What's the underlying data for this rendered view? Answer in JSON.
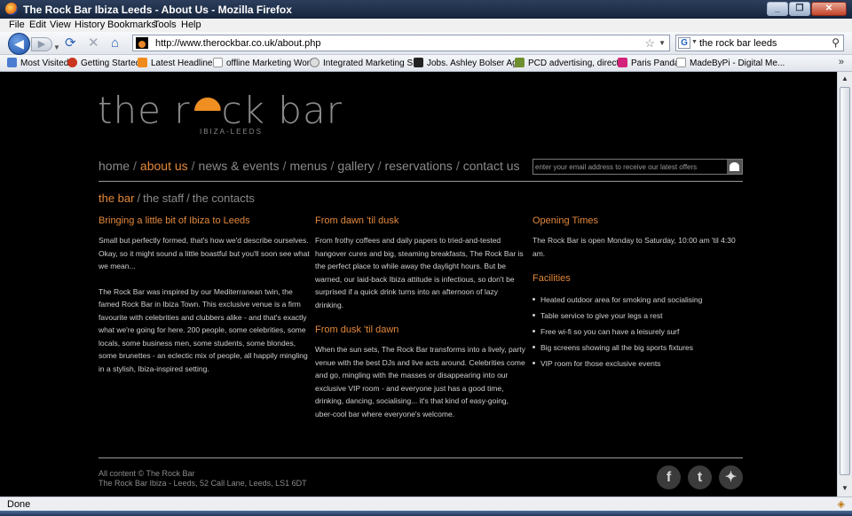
{
  "window": {
    "title": "The Rock Bar Ibiza Leeds - About Us - Mozilla Firefox"
  },
  "menubar": [
    "File",
    "Edit",
    "View",
    "History",
    "Bookmarks",
    "Tools",
    "Help"
  ],
  "navbar": {
    "url": "http://www.therockbar.co.uk/about.php",
    "search_value": "the rock bar leeds"
  },
  "bookmarks": [
    {
      "label": "Most Visited",
      "color": "#4a7dd0"
    },
    {
      "label": "Getting Started",
      "color": "#c9351e"
    },
    {
      "label": "Latest Headlines",
      "color": "#f08a1c"
    },
    {
      "label": "offline Marketing Work",
      "color": "#ffffff"
    },
    {
      "label": "Integrated Marketing S...",
      "color": "#bbbbbb"
    },
    {
      "label": "Jobs. Ashley Bolser Ag...",
      "color": "#222222"
    },
    {
      "label": "PCD advertising, direct...",
      "color": "#6d8f2f"
    },
    {
      "label": "Paris Panda",
      "color": "#d4237a"
    },
    {
      "label": "MadeByPi - Digital Me...",
      "color": "#ffffff"
    }
  ],
  "site": {
    "logo_text_before": "the r",
    "logo_text_after": "ck bar",
    "logo_sub": "IBIZA-LEEDS",
    "nav": [
      "home",
      "about us",
      "news & events",
      "menus",
      "gallery",
      "reservations",
      "contact us"
    ],
    "newsletter_placeholder": "enter your email address to receive our latest offers",
    "subnav": [
      "the bar",
      "the staff",
      "the contacts"
    ],
    "columns": {
      "left": {
        "heading": "Bringing a little bit of Ibiza to Leeds",
        "p1": "Small but perfectly formed, that's how we'd describe ourselves. Okay, so it might sound a little boastful but you'll soon see what we mean...",
        "p2": "The Rock Bar was inspired by our Mediterranean twin, the famed Rock Bar in Ibiza Town. This exclusive venue is a firm favourite with celebrities and clubbers alike - and that's exactly what we're going for here. 200 people, some celebrities, some locals, some business men, some students, some blondes, some brunettes - an eclectic mix of people, all happily mingling in a stylish, Ibiza-inspired setting."
      },
      "middle": {
        "heading1": "From dawn 'til dusk",
        "p1": "From frothy coffees and daily papers to tried-and-tested hangover cures and big, steaming breakfasts, The Rock Bar is the perfect place to while away the daylight hours. But be warned, our laid-back Ibiza attitude is infectious, so don't be surprised if a quick drink turns into an afternoon of lazy drinking.",
        "heading2": "From dusk 'til dawn",
        "p2": "When the sun sets, The Rock Bar transforms into a lively, party venue with the best DJs and live acts around. Celebrities come and go, mingling with the masses or disappearing into our exclusive VIP room - and everyone just has a good time, drinking, dancing, socialising... it's that kind of easy-going, uber-cool bar where everyone's welcome."
      },
      "right": {
        "heading1": "Opening Times",
        "p1": "The Rock Bar is open Monday to Saturday, 10:00 am 'til 4:30 am.",
        "heading2": "Facilities",
        "facilities": [
          "Heated outdoor area for smoking and socialising",
          "Table service to give your legs a rest",
          "Free wi-fi so you can have a leisurely surf",
          "Big screens showing all the big sports fixtures",
          "VIP room for those exclusive events"
        ]
      }
    },
    "footer": {
      "line1": "All content © The Rock Bar",
      "line2": "The Rock Bar Ibiza - Leeds, 52 Call Lane, Leeds, LS1 6DT"
    },
    "social": [
      "facebook-icon",
      "twitter-icon",
      "myspace-icon"
    ]
  },
  "status": {
    "text": "Done"
  },
  "colors": {
    "accent": "#e3883a",
    "background": "#000000",
    "nav_text": "#8a8a8a"
  }
}
